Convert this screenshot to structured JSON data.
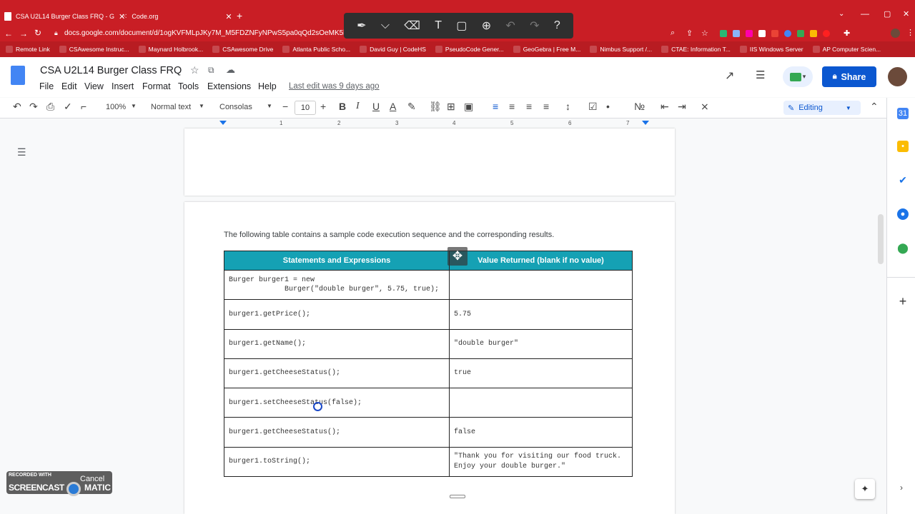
{
  "browser": {
    "tabs": [
      {
        "label": "CSA U2L14 Burger Class FRQ - G"
      },
      {
        "label": "Code.org"
      }
    ],
    "url": "docs.google.com/document/d/1ogKVFMLpJKy7M_M5FDZNFyNPwS5pa0qQd2sOeMK5h2o/e",
    "bookmarks": [
      {
        "label": "Remote Link"
      },
      {
        "label": "CSAwesome Instruc..."
      },
      {
        "label": "Maynard Holbrook..."
      },
      {
        "label": "CSAwesome Drive"
      },
      {
        "label": "Atlanta Public Scho..."
      },
      {
        "label": "David Guy | CodeHS"
      },
      {
        "label": "PseudoCode Gener..."
      },
      {
        "label": "GeoGebra | Free M..."
      },
      {
        "label": "Nimbus Support /..."
      },
      {
        "label": "CTAE: Information T..."
      },
      {
        "label": "IIS Windows Server"
      },
      {
        "label": "AP Computer Scien..."
      }
    ]
  },
  "doc": {
    "title": "CSA U2L14 Burger Class FRQ",
    "menus": [
      "File",
      "Edit",
      "View",
      "Insert",
      "Format",
      "Tools",
      "Extensions",
      "Help"
    ],
    "last_edit": "Last edit was 9 days ago",
    "share_label": "Share"
  },
  "toolbar": {
    "zoom": "100%",
    "style": "Normal text",
    "font": "Consolas",
    "font_size": "10",
    "mode": "Editing"
  },
  "ruler": [
    "1",
    "2",
    "3",
    "4",
    "5",
    "6",
    "7"
  ],
  "content": {
    "intro": "The following table contains a sample code execution sequence and the corresponding results.",
    "table": {
      "headers": [
        "Statements and Expressions",
        "Value Returned (blank if no value)"
      ],
      "rows": [
        {
          "statement": "Burger burger1 = new\n             Burger(\"double burger\", 5.75, true);",
          "value": ""
        },
        {
          "statement": "burger1.getPrice();",
          "value": "5.75"
        },
        {
          "statement": "burger1.getName();",
          "value": "\"double burger\""
        },
        {
          "statement": "burger1.getCheeseStatus();",
          "value": "true"
        },
        {
          "statement": "burger1.setCheeseStatus(false);",
          "value": ""
        },
        {
          "statement": "burger1.getCheeseStatus();",
          "value": "false"
        },
        {
          "statement": "burger1.toString();",
          "value": "\"Thank you for visiting our food truck.\nEnjoy your double burger.\""
        }
      ]
    }
  },
  "overlay": {
    "recorded_with": "RECORDED WITH",
    "brand": "SCREENCAST",
    "brand2": "MATIC",
    "cancel": "Cancel"
  }
}
